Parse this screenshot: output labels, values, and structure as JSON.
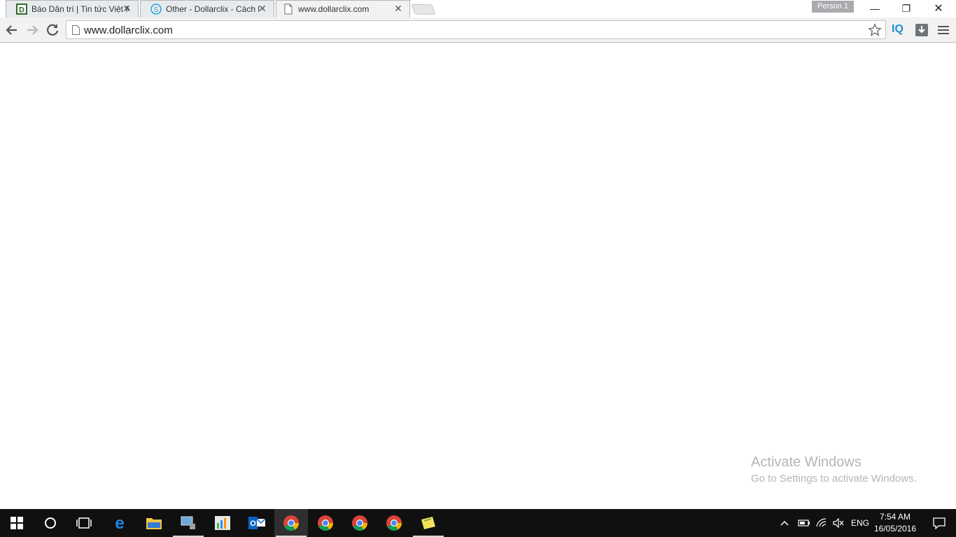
{
  "browser": {
    "tabs": [
      {
        "title": "Báo Dân trí | Tin tức Việt N",
        "favicon": "dantri-d-icon",
        "active": false
      },
      {
        "title": "Other - Dollarclix - Cách l",
        "favicon": "dollar-s-icon",
        "active": false
      },
      {
        "title": "www.dollarclix.com",
        "favicon": "page-icon",
        "active": true
      }
    ],
    "close_glyph": "✕",
    "profile_label": "Person 1",
    "window_controls": {
      "minimize": "—",
      "restore": "❐",
      "close": "✕"
    },
    "address_bar": {
      "url": "www.dollarclix.com"
    },
    "extensions": {
      "iq_label": "IQ"
    }
  },
  "watermark": {
    "line1": "Activate Windows",
    "line2": "Go to Settings to activate Windows."
  },
  "taskbar": {
    "apps": [
      {
        "name": "start-button"
      },
      {
        "name": "cortana-search-button"
      },
      {
        "name": "task-view-button"
      },
      {
        "name": "edge-app"
      },
      {
        "name": "file-explorer-app"
      },
      {
        "name": "network-tool-app"
      },
      {
        "name": "chart-app"
      },
      {
        "name": "outlook-app"
      },
      {
        "name": "chrome-app-1"
      },
      {
        "name": "chrome-app-2"
      },
      {
        "name": "chrome-app-3"
      },
      {
        "name": "chrome-app-4"
      },
      {
        "name": "sticky-notes-app"
      }
    ],
    "tray": {
      "language": "ENG",
      "time": "7:54 AM",
      "date": "16/05/2016"
    }
  },
  "colors": {
    "accent": "#1e8fd8",
    "taskbar": "#101010",
    "toolbar": "#f2f2f2"
  }
}
